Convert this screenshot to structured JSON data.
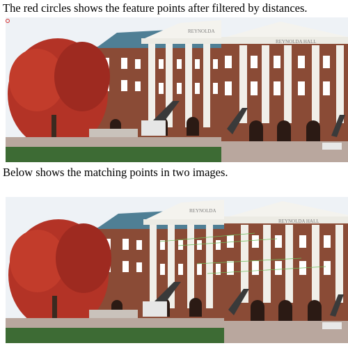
{
  "captions": {
    "top": "The red circles shows the feature points after filtered by distances.",
    "bottom": "Below shows the matching points in two images."
  },
  "figure_top": {
    "left_sign": "REYNOLDA",
    "right_sign": "REYNOLDA HALL"
  },
  "figure_bottom": {
    "left_sign": "REYNOLDA",
    "right_sign": "REYNOLDA HALL"
  },
  "colors": {
    "sky": "#e9eef3",
    "roof": "#4f7f95",
    "brick": "#8a4b36",
    "column": "#f0efea",
    "tree": "#b33326",
    "grass": "#3d6b34",
    "path": "#b9a79e",
    "feature_circle": "#d62b2b",
    "match_line": "#6bbf59"
  }
}
